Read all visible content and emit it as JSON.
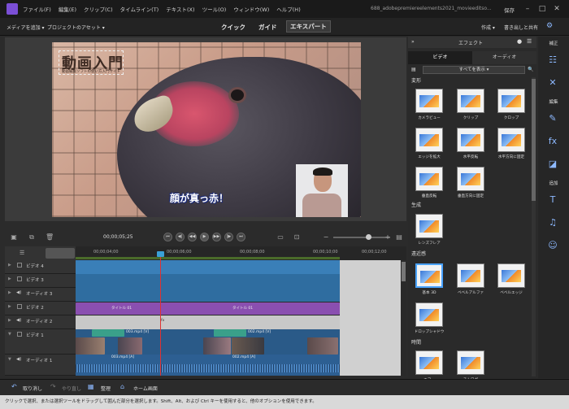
{
  "menu": [
    "ファイル(F)",
    "編集(E)",
    "クリップ(C)",
    "タイムライン(T)",
    "テキスト(X)",
    "ツール(O)",
    "ウィンドウ(W)",
    "ヘルプ(H)"
  ],
  "window_title": "688_adobepremiereelements2021_movieeditso...",
  "save_label": "保存",
  "toolbar": {
    "add_media": "メディアを追加 ▾",
    "project_assets": "プロジェクトのアセット ▾",
    "modes": [
      "クイック",
      "ガイド",
      "エキスパート"
    ],
    "create": "作成 ▾",
    "export": "書き出しと共有"
  },
  "preview": {
    "logo_text": "動画入門",
    "logo_sub": "動画編集ソフトの使い方入門サイト",
    "caption": "顔が真っ赤！"
  },
  "controls": {
    "timecode": "00;00;05;25",
    "zoom_minus": "−",
    "zoom_plus": "+"
  },
  "ruler": [
    "00;00;04;00",
    "00;00;06;00",
    "00;00;08;00",
    "00;00;10;00",
    "00;00;12;00"
  ],
  "tracks": [
    {
      "name": "ビデオ 4"
    },
    {
      "name": "ビデオ 3"
    },
    {
      "name": "オーディオ 3"
    },
    {
      "name": "ビデオ 2"
    },
    {
      "name": "オーディオ 2"
    },
    {
      "name": "ビデオ 1"
    },
    {
      "name": "オーディオ 1"
    }
  ],
  "clips": {
    "title1": "タイトル 01",
    "title2": "タイトル 01",
    "fx": "fx",
    "v1a": "003.mp4 [V]",
    "v1b": "002.mp4 [V]",
    "a1a": "003.mp4 [A]",
    "a1b": "002.mp4 [A]"
  },
  "effects": {
    "header": "エフェクト",
    "tabs": [
      "ビデオ",
      "オーディオ"
    ],
    "filter": "すべてを表示 ▾",
    "categories": [
      "変形",
      "生成",
      "遠近感",
      "時間"
    ],
    "items": [
      [
        "カメラビュー",
        "クリップ",
        "クロップ"
      ],
      [
        "エッジを拡大",
        "水平反転",
        "水平方向に固定"
      ],
      [
        "垂直反転",
        "垂直方向に固定"
      ],
      [
        "レンズフレア"
      ],
      [
        "基本 3D",
        "ベベルアルファ",
        "ベベルエッジ"
      ],
      [
        "ドロップシャドウ"
      ],
      [
        "エコー",
        "ストロボ"
      ]
    ]
  },
  "rail": [
    "補正",
    "編集",
    "追加"
  ],
  "bottom": {
    "undo": "取り消し",
    "redo": "やり直し",
    "organize": "整理",
    "home": "ホーム画面"
  },
  "status": "クリックで選択、または選択ツールをドラッグして囲んだ部分を選択します。Shift、Alt、および Ctrl キーを使用すると、他のオプションを使用できます。"
}
